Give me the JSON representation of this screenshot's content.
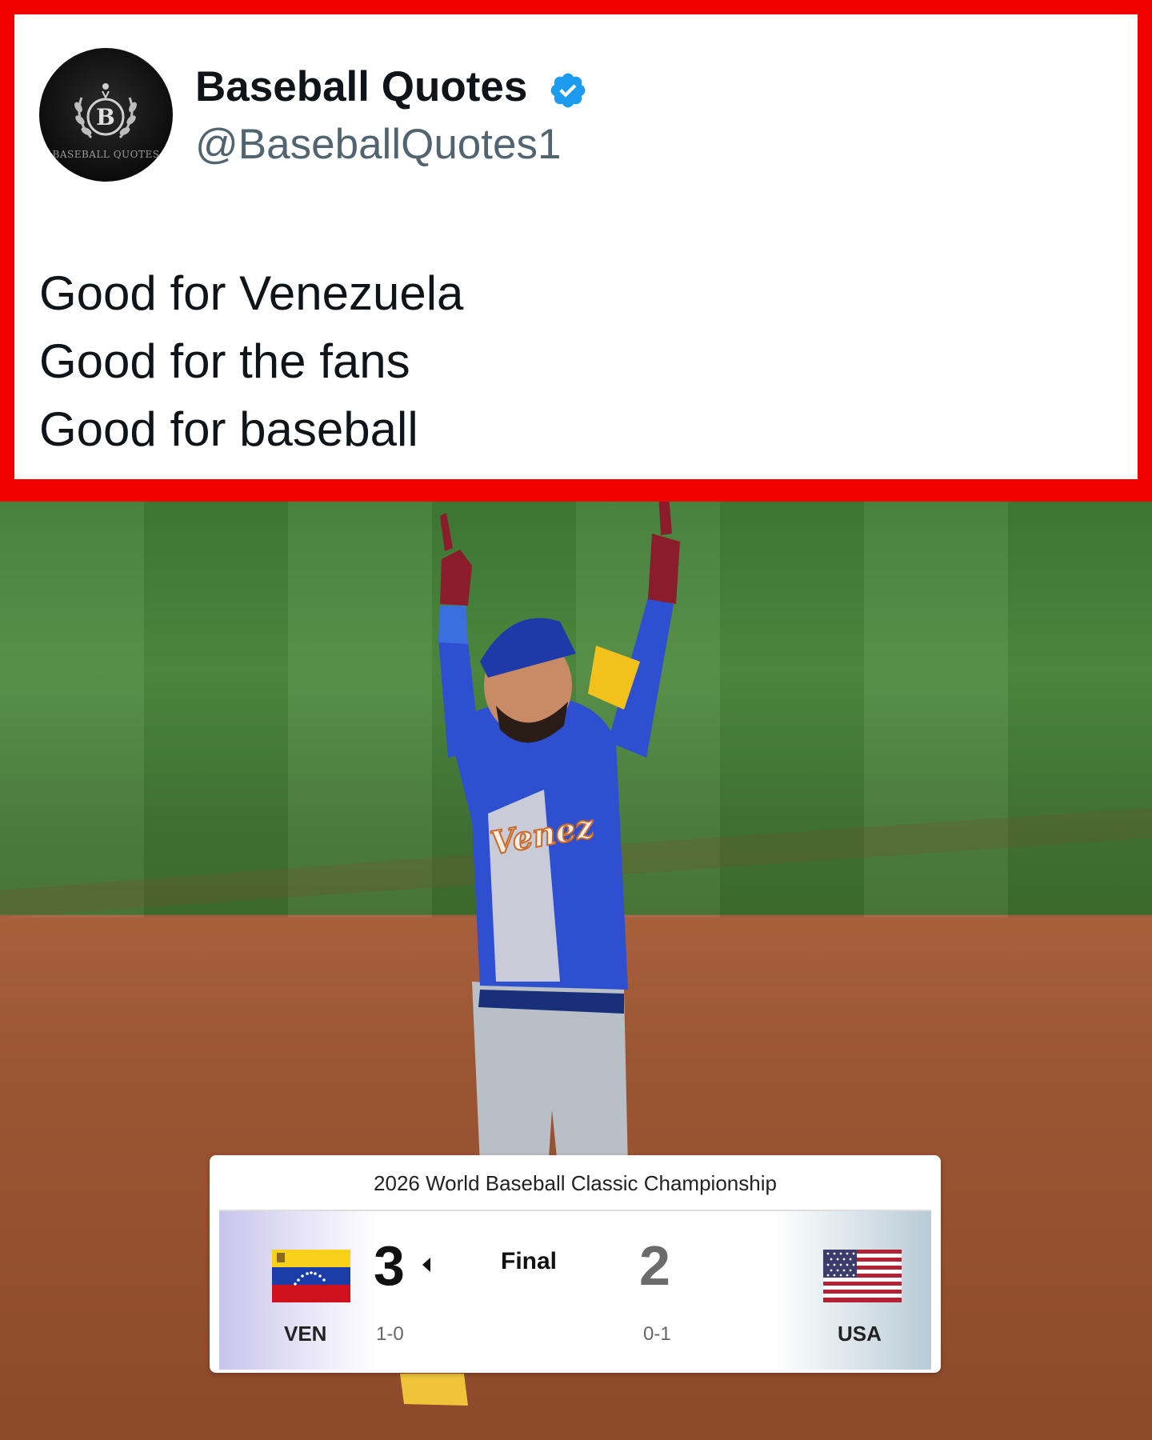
{
  "tweet": {
    "author_name": "Baseball Quotes",
    "handle": "@BaseballQuotes1",
    "avatar_letter": "B",
    "avatar_text": "BASEBALL QUOTES",
    "lines": [
      "Good for Venezuela",
      "Good for the fans",
      "Good for baseball"
    ],
    "frame_color": "#f20000",
    "verified_color": "#1d9bf0"
  },
  "photo": {
    "jersey_text": "Venez"
  },
  "scoreboard": {
    "title": "2026 World Baseball Classic Championship",
    "status": "Final",
    "home": {
      "abbr": "VEN",
      "score": "3",
      "record": "1-0",
      "flag": "venezuela-flag"
    },
    "away": {
      "abbr": "USA",
      "score": "2",
      "record": "0-1",
      "flag": "usa-flag"
    }
  }
}
